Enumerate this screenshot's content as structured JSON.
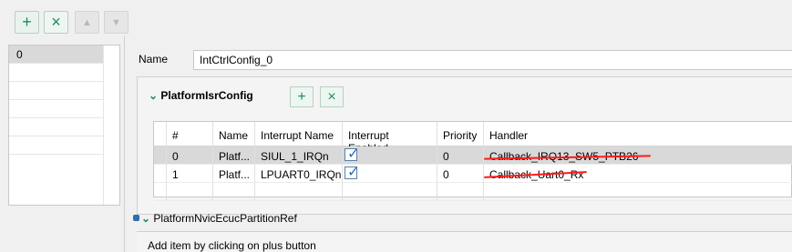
{
  "toolbar": {
    "add_icon": "plus-icon",
    "delete_icon": "x-icon",
    "up_icon": "chevron-up-icon",
    "down_icon": "chevron-down-icon",
    "add": "+",
    "delete": "×",
    "up": "▲",
    "down": "▼"
  },
  "left_list": {
    "selected_item": "0"
  },
  "name_field": {
    "label": "Name",
    "value": "IntCtrlConfig_0"
  },
  "platform_isr_section": {
    "title": "PlatformIsrConfig",
    "add": "+",
    "delete": "×"
  },
  "table": {
    "headers": [
      "#",
      "Name",
      "Interrupt Name",
      "Interrupt Enabled",
      "Priority",
      "Handler"
    ],
    "rows": [
      {
        "index": "0",
        "name": "Platf...",
        "interrupt_name": "SIUL_1_IRQn",
        "enabled": true,
        "priority": "0",
        "handler": "Callback_IRQ13_SW5_PTB26"
      },
      {
        "index": "1",
        "name": "Platf...",
        "interrupt_name": "LPUART0_IRQn",
        "enabled": true,
        "priority": "0",
        "handler": "Callback_Uart0_Rx"
      }
    ]
  },
  "nvic_section": {
    "title": "PlatformNvicEcucPartitionRef",
    "hint": "Add item by clicking on plus button"
  },
  "colors": {
    "accent_green": "#1f8a5b",
    "selection_gray": "#d9d9d9",
    "annotation_red": "#ff1a1a",
    "checkbox_blue": "#2d6fb2"
  }
}
